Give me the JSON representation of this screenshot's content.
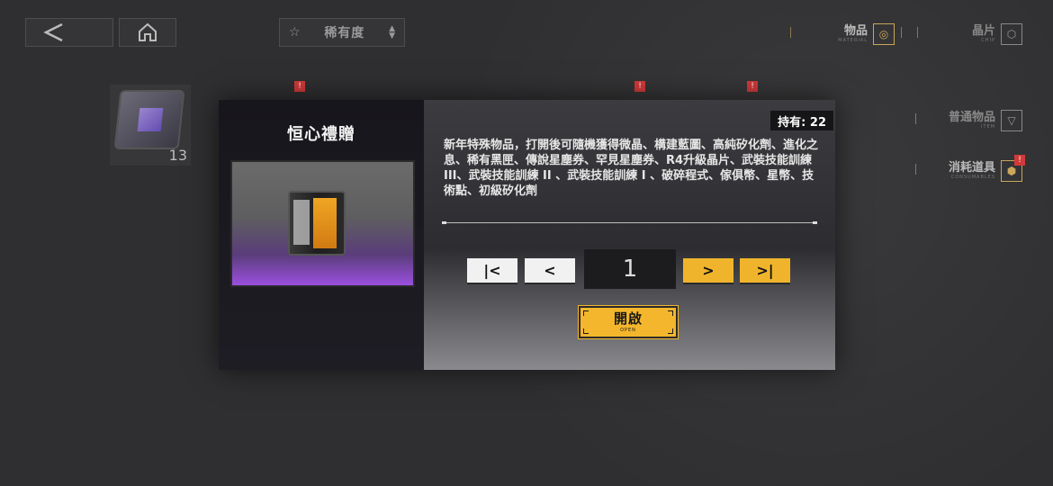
{
  "topbar": {
    "back_icon": "chevron-left-icon",
    "home_icon": "home-icon",
    "sort_label": "稀有度",
    "sort_star": "☆"
  },
  "categories": [
    {
      "zh": "物品",
      "en": "MATERIAL",
      "icon": "material-icon",
      "active": true
    },
    {
      "zh": "晶片",
      "en": "CHIP",
      "icon": "chip-icon",
      "active": false
    },
    {
      "zh": "普通物品",
      "en": "ITEM",
      "icon": "item-icon",
      "active": false
    },
    {
      "zh": "消耗道具",
      "en": "CONSUMABLES",
      "icon": "consumables-icon",
      "active": true
    }
  ],
  "badges": {
    "exclamation": "!"
  },
  "inventory": {
    "count": "13"
  },
  "modal": {
    "title": "恒心禮贈",
    "holding": "持有: 22",
    "description": "新年特殊物品，打開後可隨機獲得微晶、構建藍圖、高純矽化劑、進化之息、稀有黑匣、傳說星塵券、罕見星塵券、R4升級晶片、武裝技能訓練III、武裝技能訓練 II 、武裝技能訓練 I 、破碎程式、傢俱幣、星幣、技術點、初級矽化劑",
    "quantity": "1",
    "first_label": "|<",
    "prev_label": "<",
    "next_label": ">",
    "last_label": ">|",
    "open_zh": "開啟",
    "open_en": "OPEN"
  },
  "colors": {
    "accent_gold": "#f0b42c",
    "rarity_purple": "#9b4fe0",
    "badge_red": "#d23a3a"
  }
}
